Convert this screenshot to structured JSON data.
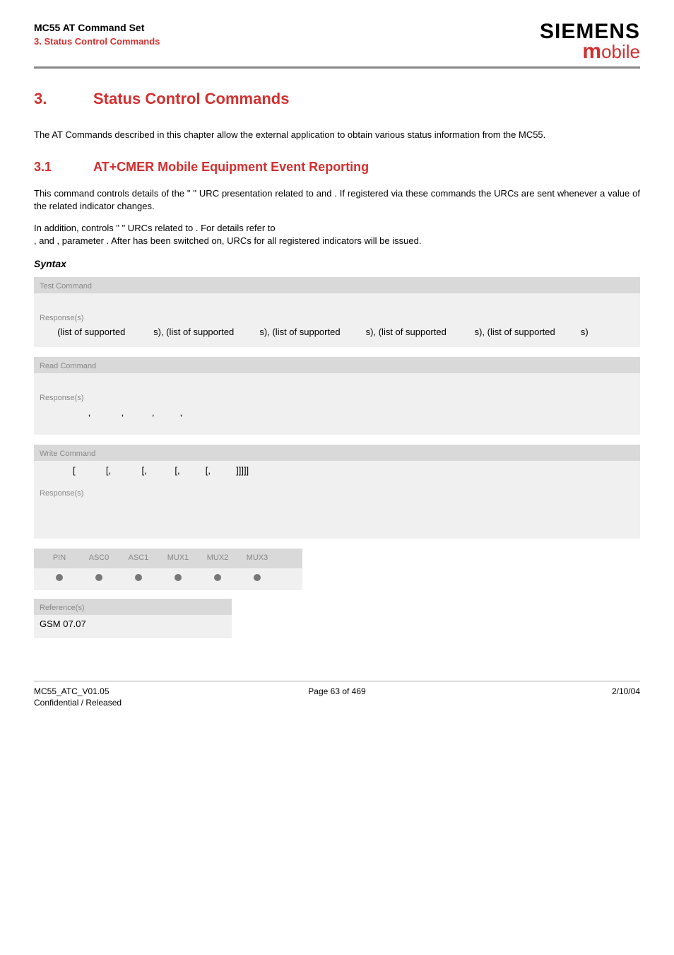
{
  "header": {
    "doc_title": "MC55 AT Command Set",
    "chapter_label": "3. Status Control Commands",
    "brand_top": "SIEMENS",
    "brand_bottom_m": "m",
    "brand_bottom_rest": "obile"
  },
  "section": {
    "num": "3.",
    "title": "Status Control Commands"
  },
  "intro": "The AT Commands described in this chapter allow the external application to obtain various status information from the MC55.",
  "subsection": {
    "num": "3.1",
    "title": "AT+CMER   Mobile Equipment Event Reporting"
  },
  "desc1": "This command controls details of the \"         \" URC presentation related to                  and              . If registered via these commands the URCs are sent whenever a value of the related indicator changes.",
  "desc2": "In addition,                 controls \"          \" URCs related to                 . For details refer to",
  "desc3": "          ,                and              , parameter             . After                has been switched on, URCs for all registered indicators will be issued.",
  "syntax_label": "Syntax",
  "test_cmd": {
    "header": "Test Command",
    "resp_label": "Response(s)",
    "resp_text": "       (list of supported           s), (list of supported          s), (list of supported          s), (list of supported           s), (list of supported          s)"
  },
  "read_cmd": {
    "header": "Read Command",
    "resp_label": "Response(s)",
    "resp_text": "                   ,            ,           ,          ,"
  },
  "write_cmd": {
    "header": "Write Command",
    "cmd_text": "             [            [,            [,           [,          [,          ]]]]]",
    "resp_label": "Response(s)"
  },
  "dots": {
    "headers": [
      "PIN",
      "ASC0",
      "ASC1",
      "MUX1",
      "MUX2",
      "MUX3"
    ]
  },
  "ref": {
    "header": "Reference(s)",
    "body": "GSM 07.07"
  },
  "footer": {
    "left1": "MC55_ATC_V01.05",
    "left2": "Confidential / Released",
    "center": "Page 63 of 469",
    "right": "2/10/04"
  }
}
